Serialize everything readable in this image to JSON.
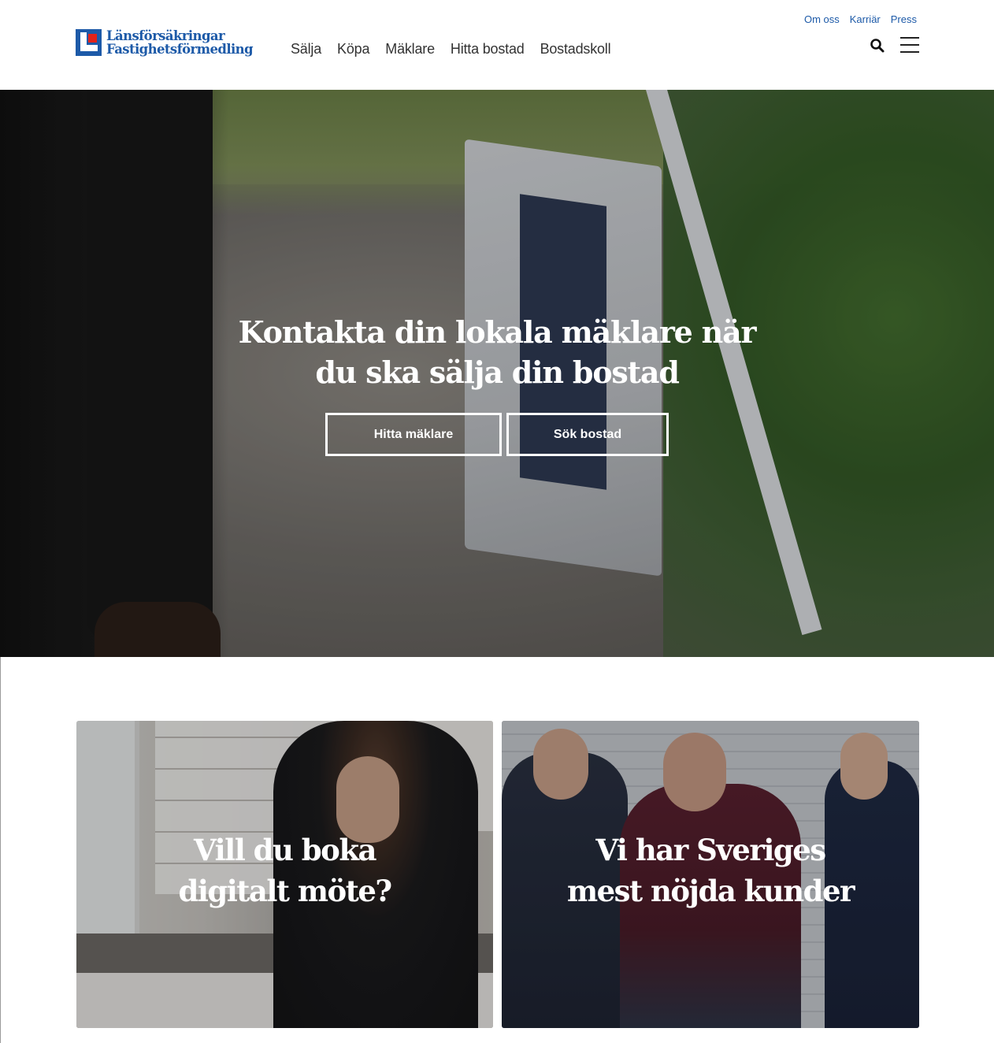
{
  "header": {
    "logo": {
      "line1": "Länsförsäkringar",
      "line2": "Fastighetsförmedling"
    },
    "nav": [
      {
        "label": "Sälja"
      },
      {
        "label": "Köpa"
      },
      {
        "label": "Mäklare"
      },
      {
        "label": "Hitta bostad"
      },
      {
        "label": "Bostadskoll"
      }
    ],
    "top_links": [
      {
        "label": "Om oss"
      },
      {
        "label": "Karriär"
      },
      {
        "label": "Press"
      }
    ],
    "search_icon": "search-icon",
    "menu_icon": "hamburger-menu-icon"
  },
  "hero": {
    "title_line1": "Kontakta din lokala mäklare när",
    "title_line2": "du ska sälja din bostad",
    "buttons": [
      {
        "label": "Hitta mäklare"
      },
      {
        "label": "Sök bostad"
      }
    ]
  },
  "cards": [
    {
      "title_line1": "Vill du boka",
      "title_line2": "digitalt möte?"
    },
    {
      "title_line1": "Vi har Sveriges",
      "title_line2": "mest nöjda kunder"
    }
  ],
  "colors": {
    "brand_blue": "#1d5aa8",
    "brand_red": "#e2231a",
    "text": "#333333",
    "white": "#ffffff"
  }
}
